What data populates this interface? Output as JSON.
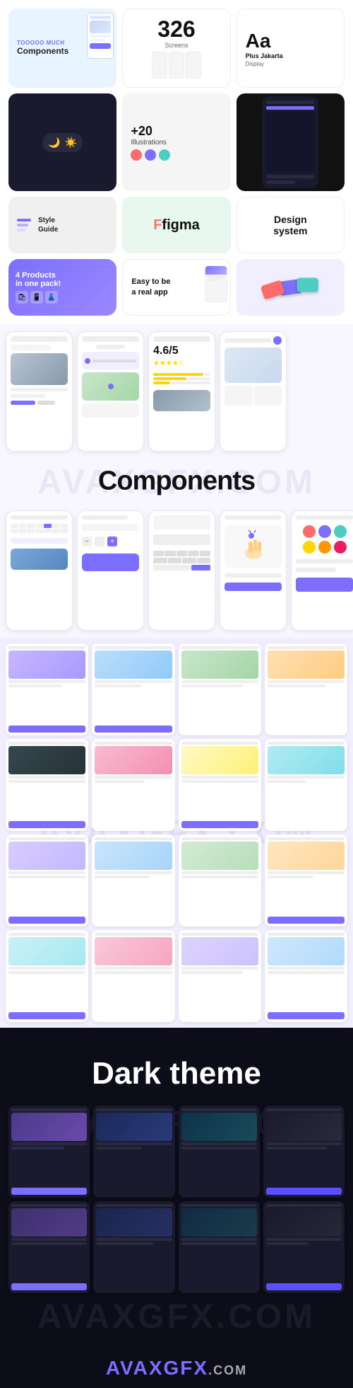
{
  "top": {
    "components_label": "Tooooo much",
    "components_title": "Components",
    "screens_number": "326",
    "screens_label": "Screens",
    "font_aa": "Aa",
    "font_name": "Plus Jakarta",
    "font_sub": "Display",
    "dark_toggle": "dark/light",
    "illustrations_plus": "+20",
    "illustrations_label": "Illustrations",
    "style_guide_label": "Style\nGuide",
    "figma_label": "figma",
    "design_system": "Design\nsystem",
    "products_line1": "4 Products",
    "products_line2": "in one pack!",
    "easy_app_line1": "Easy to be",
    "easy_app_line2": "a real app"
  },
  "components_section": {
    "title": "Components"
  },
  "dark_section": {
    "title": "Dark theme"
  },
  "watermarks": {
    "avax_gfx": "AVAXGFX.COM",
    "avax_gfx_2": "AVAXGFX.COM",
    "avax_gfx_3": "AVAXGFX.COM"
  },
  "bottom_logo": "AVAXGFX.COM"
}
